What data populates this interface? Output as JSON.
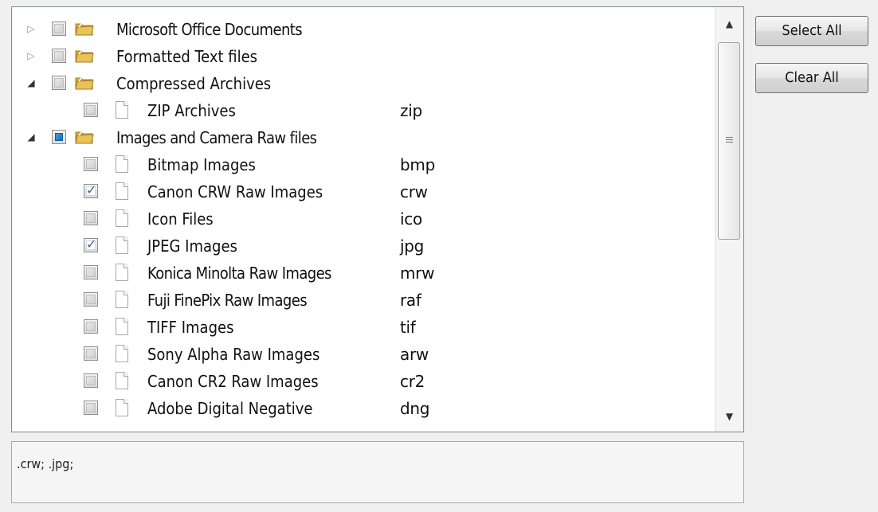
{
  "tree": {
    "rows": [
      {
        "level": 0,
        "expander": "collapsed",
        "check": "unchecked",
        "icon": "folder-icon",
        "label": "Microsoft Office Documents",
        "ext": ""
      },
      {
        "level": 0,
        "expander": "collapsed",
        "check": "unchecked",
        "icon": "folder-icon",
        "label": "Formatted Text files",
        "ext": ""
      },
      {
        "level": 0,
        "expander": "expanded",
        "check": "unchecked",
        "icon": "folder-icon",
        "label": "Compressed Archives",
        "ext": ""
      },
      {
        "level": 1,
        "expander": "",
        "check": "unchecked",
        "icon": "file-icon",
        "label": "ZIP Archives",
        "ext": "zip"
      },
      {
        "level": 0,
        "expander": "expanded",
        "check": "partial",
        "icon": "folder-icon",
        "label": "Images and Camera Raw files",
        "ext": ""
      },
      {
        "level": 1,
        "expander": "",
        "check": "unchecked",
        "icon": "file-icon",
        "label": "Bitmap Images",
        "ext": "bmp"
      },
      {
        "level": 1,
        "expander": "",
        "check": "checked",
        "icon": "file-icon",
        "label": "Canon CRW Raw Images",
        "ext": "crw"
      },
      {
        "level": 1,
        "expander": "",
        "check": "unchecked",
        "icon": "file-icon",
        "label": "Icon Files",
        "ext": "ico"
      },
      {
        "level": 1,
        "expander": "",
        "check": "checked",
        "icon": "file-icon",
        "label": "JPEG Images",
        "ext": "jpg"
      },
      {
        "level": 1,
        "expander": "",
        "check": "unchecked",
        "icon": "file-icon",
        "label": "Konica Minolta Raw Images",
        "ext": "mrw"
      },
      {
        "level": 1,
        "expander": "",
        "check": "unchecked",
        "icon": "file-icon",
        "label": "Fuji FinePix Raw Images",
        "ext": "raf"
      },
      {
        "level": 1,
        "expander": "",
        "check": "unchecked",
        "icon": "file-icon",
        "label": "TIFF Images",
        "ext": "tif"
      },
      {
        "level": 1,
        "expander": "",
        "check": "unchecked",
        "icon": "file-icon",
        "label": "Sony Alpha Raw Images",
        "ext": "arw"
      },
      {
        "level": 1,
        "expander": "",
        "check": "unchecked",
        "icon": "file-icon",
        "label": "Canon CR2 Raw Images",
        "ext": "cr2"
      },
      {
        "level": 1,
        "expander": "",
        "check": "unchecked",
        "icon": "file-icon",
        "label": "Adobe Digital Negative",
        "ext": "dng"
      }
    ]
  },
  "scrollbar": {
    "up_icon": "scroll-up-arrow-icon",
    "down_icon": "scroll-down-arrow-icon"
  },
  "buttons": {
    "select_all": "Select All",
    "clear_all": "Clear All"
  },
  "summary": {
    "text": ".crw; .jpg;"
  },
  "colors": {
    "partial_check": "#1d6fae",
    "check_mark": "#3c5e9b",
    "folder": "#e8c35a"
  }
}
